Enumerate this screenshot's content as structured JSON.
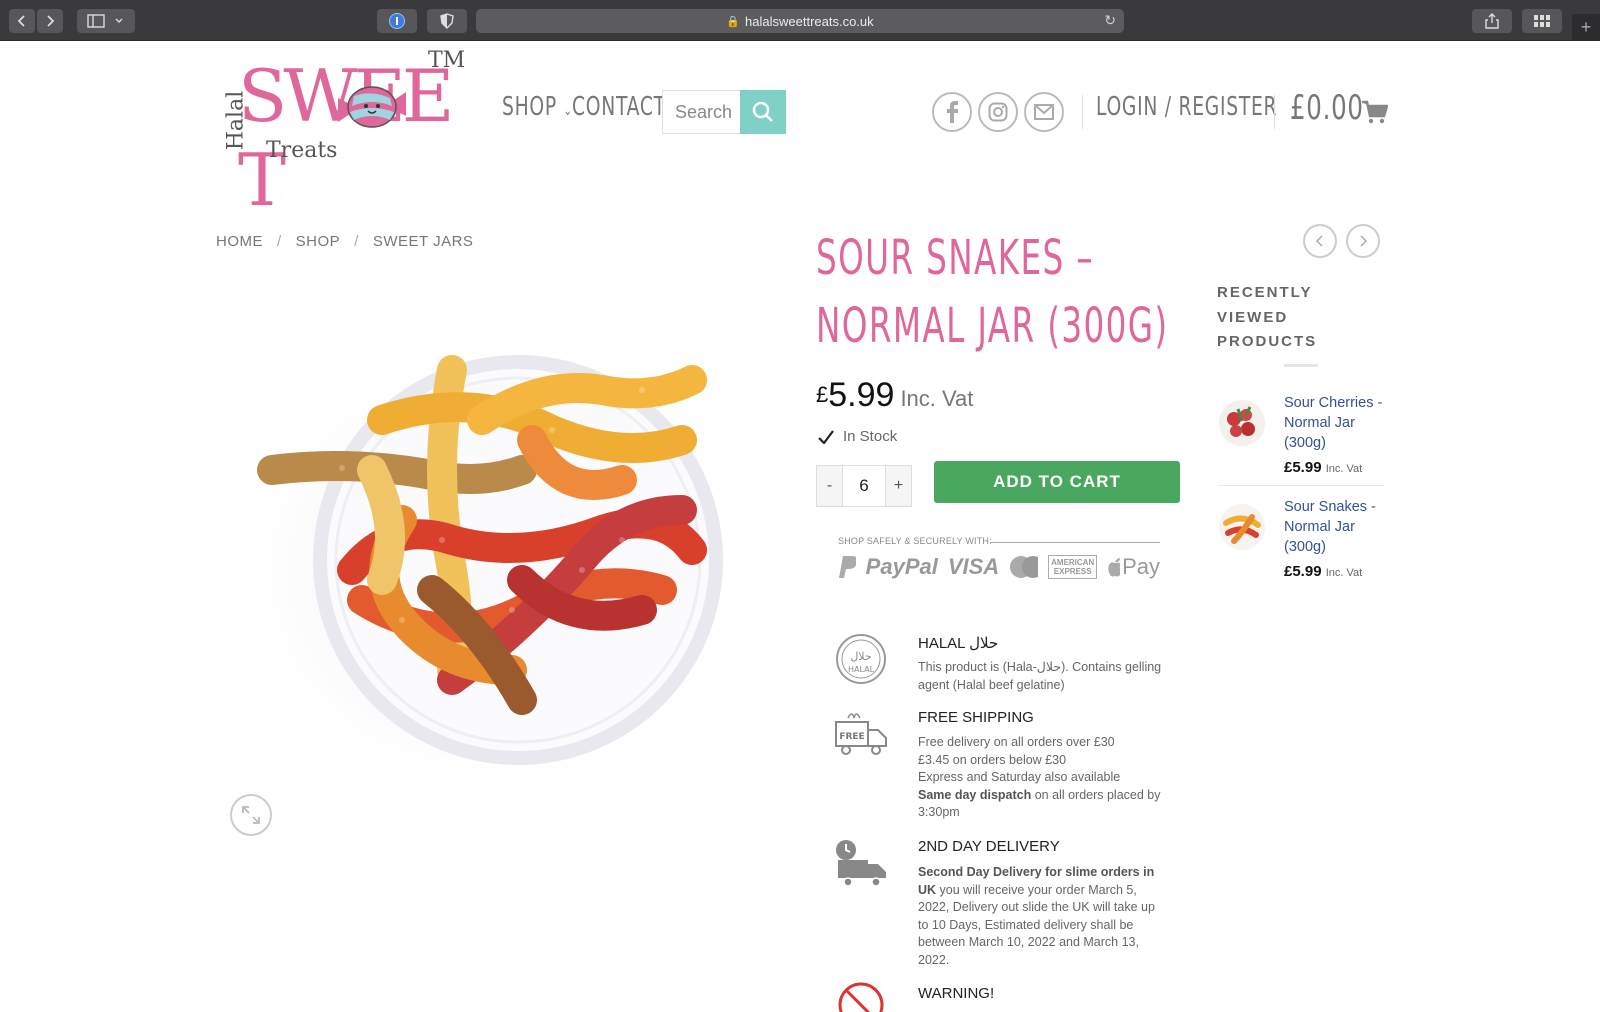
{
  "browser": {
    "url": "halalsweettreats.co.uk"
  },
  "logo": {
    "halal": "Halal",
    "sweet": "SWEE T",
    "treats": "Treats",
    "tm": "TM"
  },
  "nav": {
    "shop": "SHOP",
    "contact": "CONTACT",
    "search_placeholder": "Search",
    "login": "LOGIN / REGISTER",
    "cart_total": "£0.00"
  },
  "breadcrumb": [
    "HOME",
    "SHOP",
    "SWEET JARS"
  ],
  "product": {
    "title": "SOUR SNAKES – NORMAL JAR (300G)",
    "currency": "£",
    "price": "5.99",
    "vat": "Inc. Vat",
    "stock": "In Stock",
    "qty_minus": "-",
    "qty": "6",
    "qty_plus": "+",
    "add_to_cart": "ADD TO CART",
    "pay_label": "SHOP SAFELY & SECURELY WITH:",
    "pay_paypal": "PayPal",
    "pay_visa": "VISA",
    "pay_amex": "AMERICAN EXPRESS",
    "pay_apple": "Pay"
  },
  "features": [
    {
      "title": "HALAL حلال",
      "text": "This product is (Hala-حلال). Contains gelling agent (Halal beef gelatine)"
    },
    {
      "title": "FREE SHIPPING",
      "lines": [
        "Free delivery on all orders over £30",
        "£3.45 on orders below £30",
        "Express and Saturday also available"
      ],
      "bold": "Same day dispatch",
      "tail": " on all orders placed by 3:30pm"
    },
    {
      "title": "2ND DAY DELIVERY",
      "bold": "Second Day Delivery for slime orders in UK",
      "tail": " you will receive your order March 5, 2022, Delivery out slide the UK will take up to 10 Days, Estimated delivery shall be between March 10, 2022 and March 13, 2022."
    },
    {
      "title": "WARNING!"
    }
  ],
  "icons": {
    "halal_badge": "HALAL",
    "free_truck": "FREE"
  },
  "sidebar": {
    "title": "RECENTLY VIEWED PRODUCTS",
    "items": [
      {
        "name": "Sour Cherries - Normal Jar (300g)",
        "price": "£5.99",
        "vat": "Inc. Vat"
      },
      {
        "name": "Sour Snakes - Normal Jar (300g)",
        "price": "£5.99",
        "vat": "Inc. Vat"
      }
    ]
  },
  "colors": {
    "brand_pink": "#e0679b",
    "button_green": "#4aa75f",
    "search_teal": "#7fd0c7"
  }
}
